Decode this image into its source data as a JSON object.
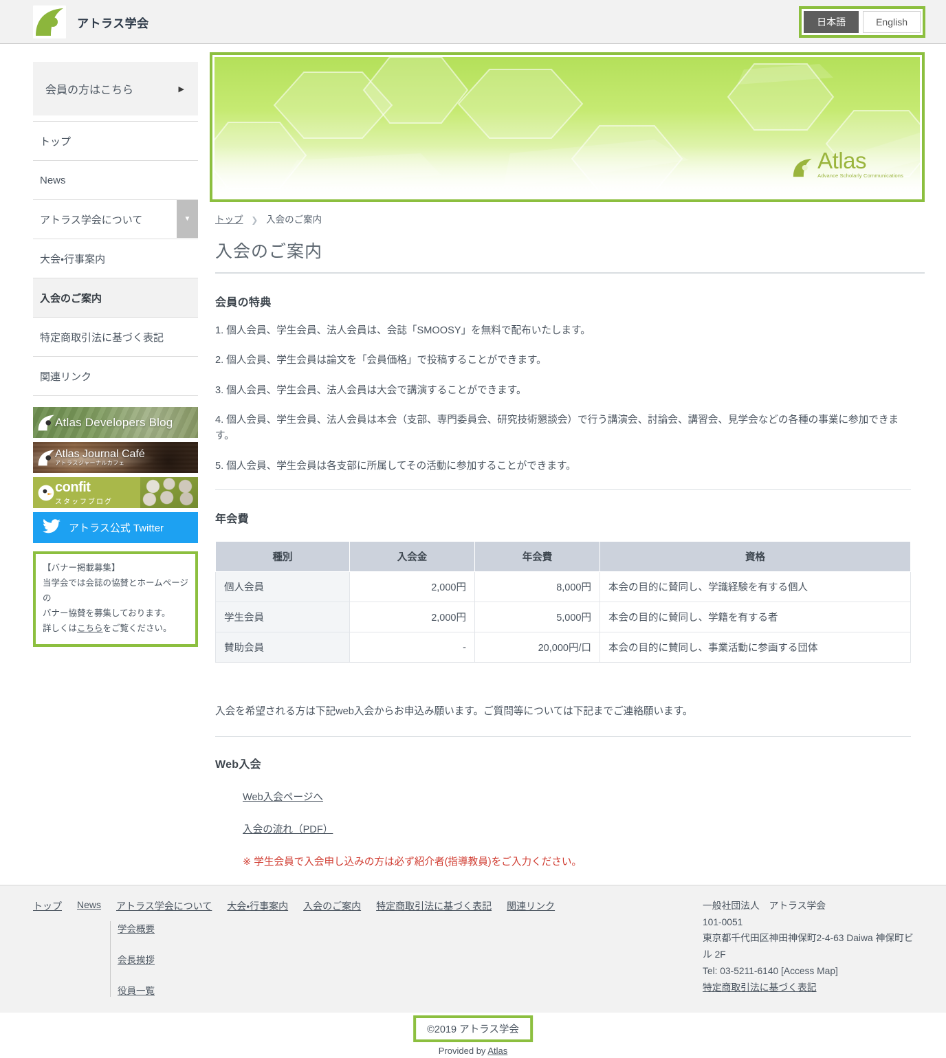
{
  "header": {
    "site_title": "アトラス学会",
    "logo_icon": "atlas-leaf-logo",
    "lang": {
      "japanese": "日本語",
      "english": "English",
      "selected": "日本語"
    }
  },
  "sidebar": {
    "member_box": {
      "label": "会員の方はこちら",
      "arrow_icon": "triangle-right-icon"
    },
    "nav_items": [
      {
        "label": "トップ",
        "current": false,
        "has_caret": false
      },
      {
        "label": "News",
        "current": false,
        "has_caret": false
      },
      {
        "label": "アトラス学会について",
        "current": false,
        "has_caret": true
      },
      {
        "label": "大会・行事案内",
        "current": false,
        "has_caret": false
      },
      {
        "label": "入会のご案内",
        "current": true,
        "has_caret": false
      },
      {
        "label": "特定商取引法に基づく表記",
        "current": false,
        "has_caret": false
      },
      {
        "label": "関連リンク",
        "current": false,
        "has_caret": false
      }
    ],
    "banners": [
      {
        "name": "atlas-developers-blog",
        "text": "Atlas Developers Blog",
        "sub": ""
      },
      {
        "name": "atlas-journal-cafe",
        "text": "Atlas Journal Café",
        "sub": "アトラスジャーナルカフェ"
      },
      {
        "name": "confit-staff-blog",
        "text": "confit",
        "sub": "スタッフブログ"
      },
      {
        "name": "atlas-official-twitter",
        "text": "アトラス公式 Twitter",
        "sub": ""
      }
    ],
    "banner_invite": {
      "title": "【バナー掲載募集】",
      "line1": "当学会では会誌の協賛とホームページの",
      "line2": "バナー協賛を募集しております。",
      "line3_pre": "詳しくは",
      "link": "こちら",
      "line3_post": "をご覧ください。"
    }
  },
  "hero": {
    "brand": "Atlas",
    "tagline": "Advance Scholarly Communications"
  },
  "breadcrumb": {
    "home": "トップ",
    "separator": "❯",
    "current": "入会のご案内"
  },
  "main": {
    "page_title": "入会のご案内",
    "benefits_heading": "会員の特典",
    "benefits": [
      "1. 個人会員、学生会員、法人会員は、会誌「SMOOSY」を無料で配布いたします。",
      "2. 個人会員、学生会員は論文を「会員価格」で投稿することができます。",
      "3. 個人会員、学生会員、法人会員は大会で講演することができます。",
      "4. 個人会員、学生会員、法人会員は本会（支部、専門委員会、研究技術懇談会）で行う講演会、討論会、講習会、見学会などの各種の事業に参加できます。",
      "5. 個人会員、学生会員は各支部に所属してその活動に参加することができます。"
    ],
    "fees_heading": "年会費",
    "fees_table": {
      "columns": [
        "種別",
        "入会金",
        "年会費",
        "資格"
      ],
      "rows": [
        [
          "個人会員",
          "2,000円",
          "8,000円",
          "本会の目的に賛同し、学識経験を有する個人"
        ],
        [
          "学生会員",
          "2,000円",
          "5,000円",
          "本会の目的に賛同し、学籍を有する者"
        ],
        [
          "賛助会員",
          "-",
          "20,000円/口",
          "本会の目的に賛同し、事業活動に参画する団体"
        ]
      ]
    },
    "apply_note": "入会を希望される方は下記web入会からお申込み願います。ご質問等については下記までご連絡願います。",
    "web_heading": "Web入会",
    "web_links": [
      "Web入会ページへ",
      "入会の流れ（PDF）"
    ],
    "student_note": "※ 学生会員で入会申し込みの方は必ず紹介者(指導教員)をご入力ください。"
  },
  "footer": {
    "nav": [
      "トップ",
      "News",
      "アトラス学会について",
      "大会・行事案内",
      "入会のご案内",
      "特定商取引法に基づく表記",
      "関連リンク"
    ],
    "sub_nav": [
      "学会概要",
      "会長挨拶",
      "役員一覧"
    ],
    "address": {
      "org": "一般社団法人　アトラス学会",
      "zip": "101-0051",
      "street": "東京都千代田区神田神保町2-4-63 Daiwa 神保町ビル 2F",
      "tel": "Tel: 03-5211-6140 [Access Map]",
      "legal_link": "特定商取引法に基づく表記"
    },
    "copyright": "©2019 アトラス学会",
    "provided_pre": "Provided by ",
    "provided_link": "Atlas"
  },
  "colors": {
    "accent_green": "#8cbf3f",
    "header_bg": "#f2f2f2",
    "table_header": "#ccd2dc",
    "twitter_blue": "#1da1f2",
    "note_red": "#d03b30"
  }
}
